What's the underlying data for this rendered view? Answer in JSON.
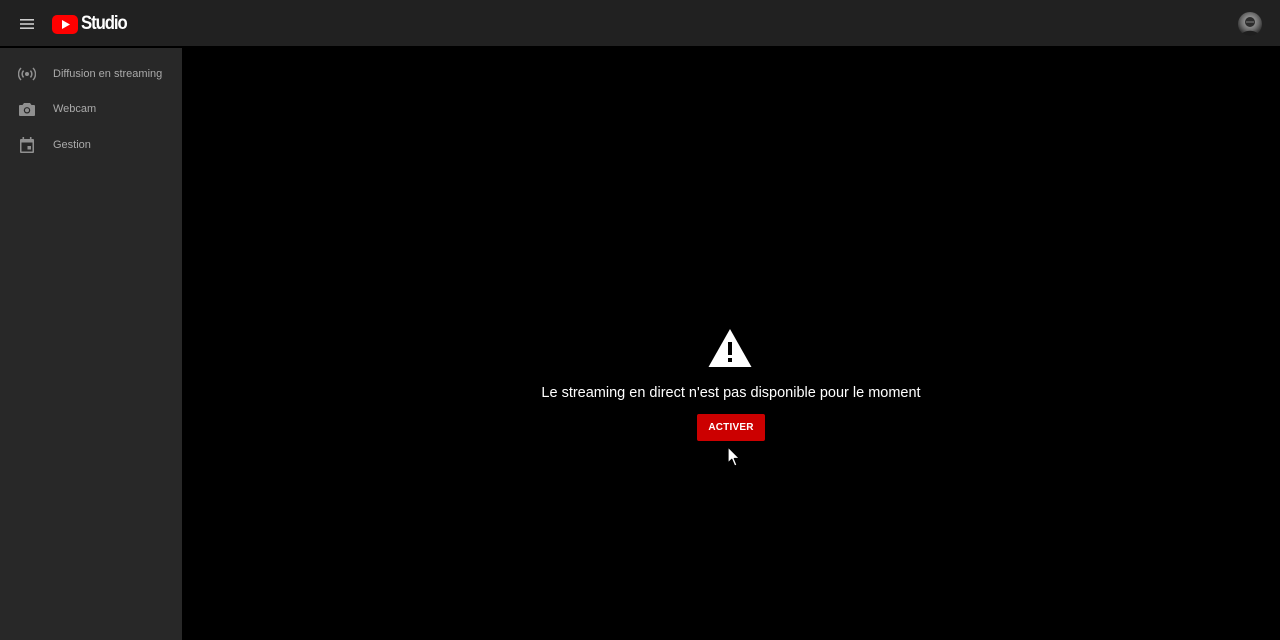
{
  "header": {
    "logo_text": "Studio",
    "icons": {
      "menu": "menu-icon",
      "logo": "youtube-logo-icon",
      "avatar": "user-avatar"
    }
  },
  "sidebar": {
    "items": [
      {
        "label": "Diffusion en streaming",
        "icon": "live-broadcast-icon"
      },
      {
        "label": "Webcam",
        "icon": "camera-icon"
      },
      {
        "label": "Gestion",
        "icon": "calendar-icon"
      }
    ]
  },
  "main": {
    "message": "Le streaming en direct n'est pas disponible pour le moment",
    "activate_label": "ACTIVER",
    "icon": "warning-icon"
  },
  "colors": {
    "topbar": "#212121",
    "sidebar": "#282828",
    "main": "#000000",
    "accent": "#cc0000",
    "sidebar_text": "#aaaaaa"
  }
}
